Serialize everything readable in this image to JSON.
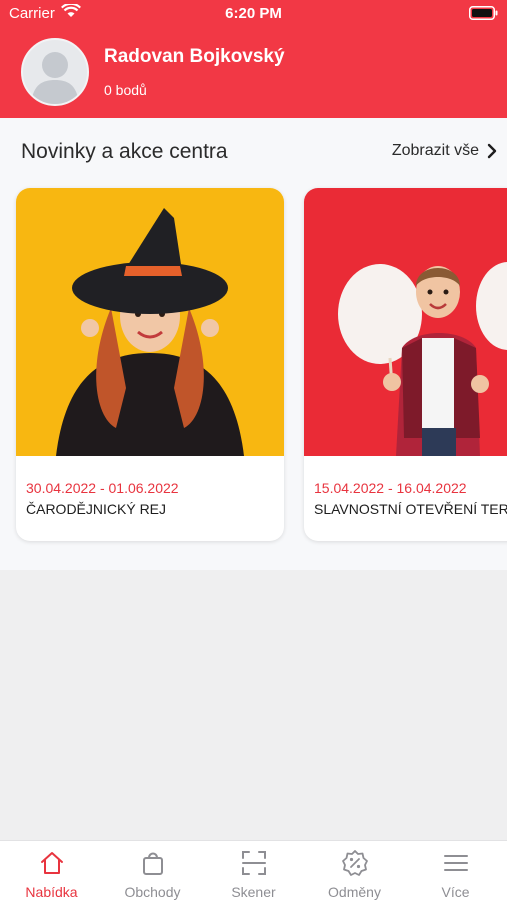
{
  "status_bar": {
    "carrier": "Carrier",
    "time": "6:20 PM"
  },
  "user": {
    "name": "Radovan Bojkovský",
    "points": "0 bodů"
  },
  "news": {
    "title": "Novinky a akce centra",
    "show_all": "Zobrazit vše",
    "cards": [
      {
        "date": "30.04.2022 - 01.06.2022",
        "title": "ČARODĚJNICKÝ REJ",
        "image": "girl-witch-hat-photo"
      },
      {
        "date": "15.04.2022 - 16.04.2022",
        "title": "SLAVNOSTNÍ OTEVŘENÍ TERASY",
        "image": "boy-cotton-candy-photo"
      }
    ]
  },
  "tabs": [
    {
      "label": "Nabídka",
      "icon": "home-icon",
      "active": true
    },
    {
      "label": "Obchody",
      "icon": "bag-icon",
      "active": false
    },
    {
      "label": "Skener",
      "icon": "scanner-icon",
      "active": false
    },
    {
      "label": "Odměny",
      "icon": "discount-badge-icon",
      "active": false
    },
    {
      "label": "Více",
      "icon": "menu-icon",
      "active": false
    }
  ],
  "colors": {
    "brand": "#f23845",
    "accent_text": "#e8343f",
    "inactive": "#8e8e93"
  }
}
